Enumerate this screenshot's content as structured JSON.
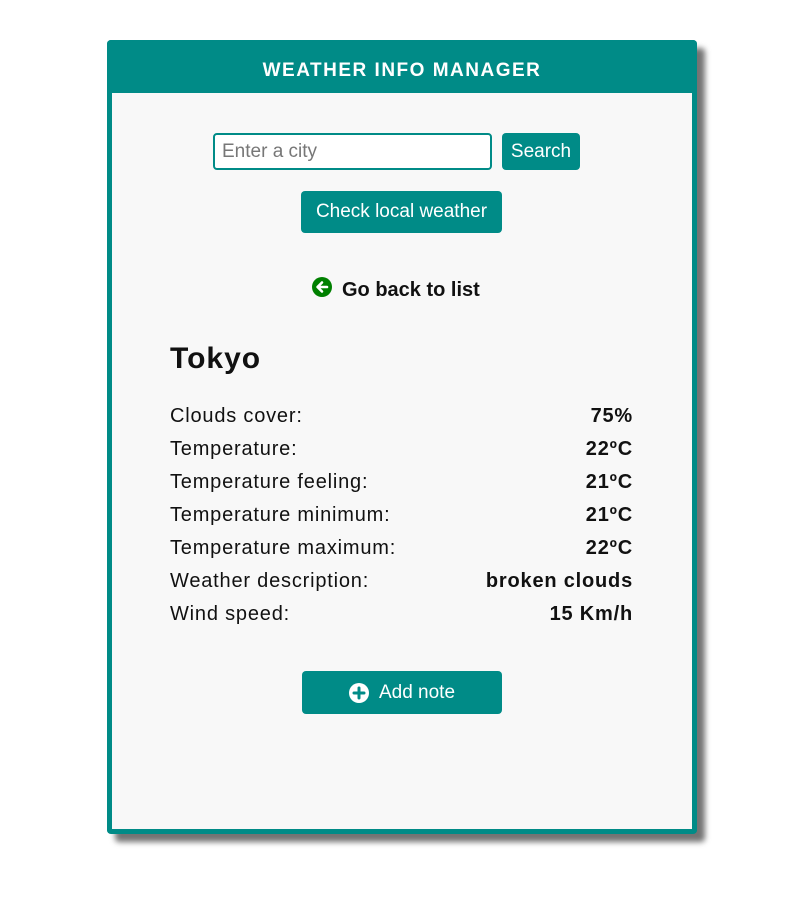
{
  "header": {
    "title": "WEATHER INFO MANAGER"
  },
  "search": {
    "placeholder": "Enter a city",
    "button_label": "Search"
  },
  "local_weather": {
    "button_label": "Check local weather"
  },
  "back": {
    "label": "Go back to list",
    "icon": "arrow-circle-left-icon",
    "icon_color": "#008000"
  },
  "city": {
    "name": "Tokyo"
  },
  "details": [
    {
      "label": "Clouds cover:",
      "value": "75%"
    },
    {
      "label": "Temperature:",
      "value": "22ºC"
    },
    {
      "label": "Temperature feeling:",
      "value": "21ºC"
    },
    {
      "label": "Temperature minimum:",
      "value": "21ºC"
    },
    {
      "label": "Temperature maximum:",
      "value": "22ºC"
    },
    {
      "label": "Weather description:",
      "value": "broken clouds"
    },
    {
      "label": "Wind speed:",
      "value": "15 Km/h"
    }
  ],
  "add_note": {
    "label": "Add note",
    "icon": "plus-circle-icon"
  },
  "colors": {
    "accent": "#008b87",
    "background": "#f8f8f8"
  }
}
